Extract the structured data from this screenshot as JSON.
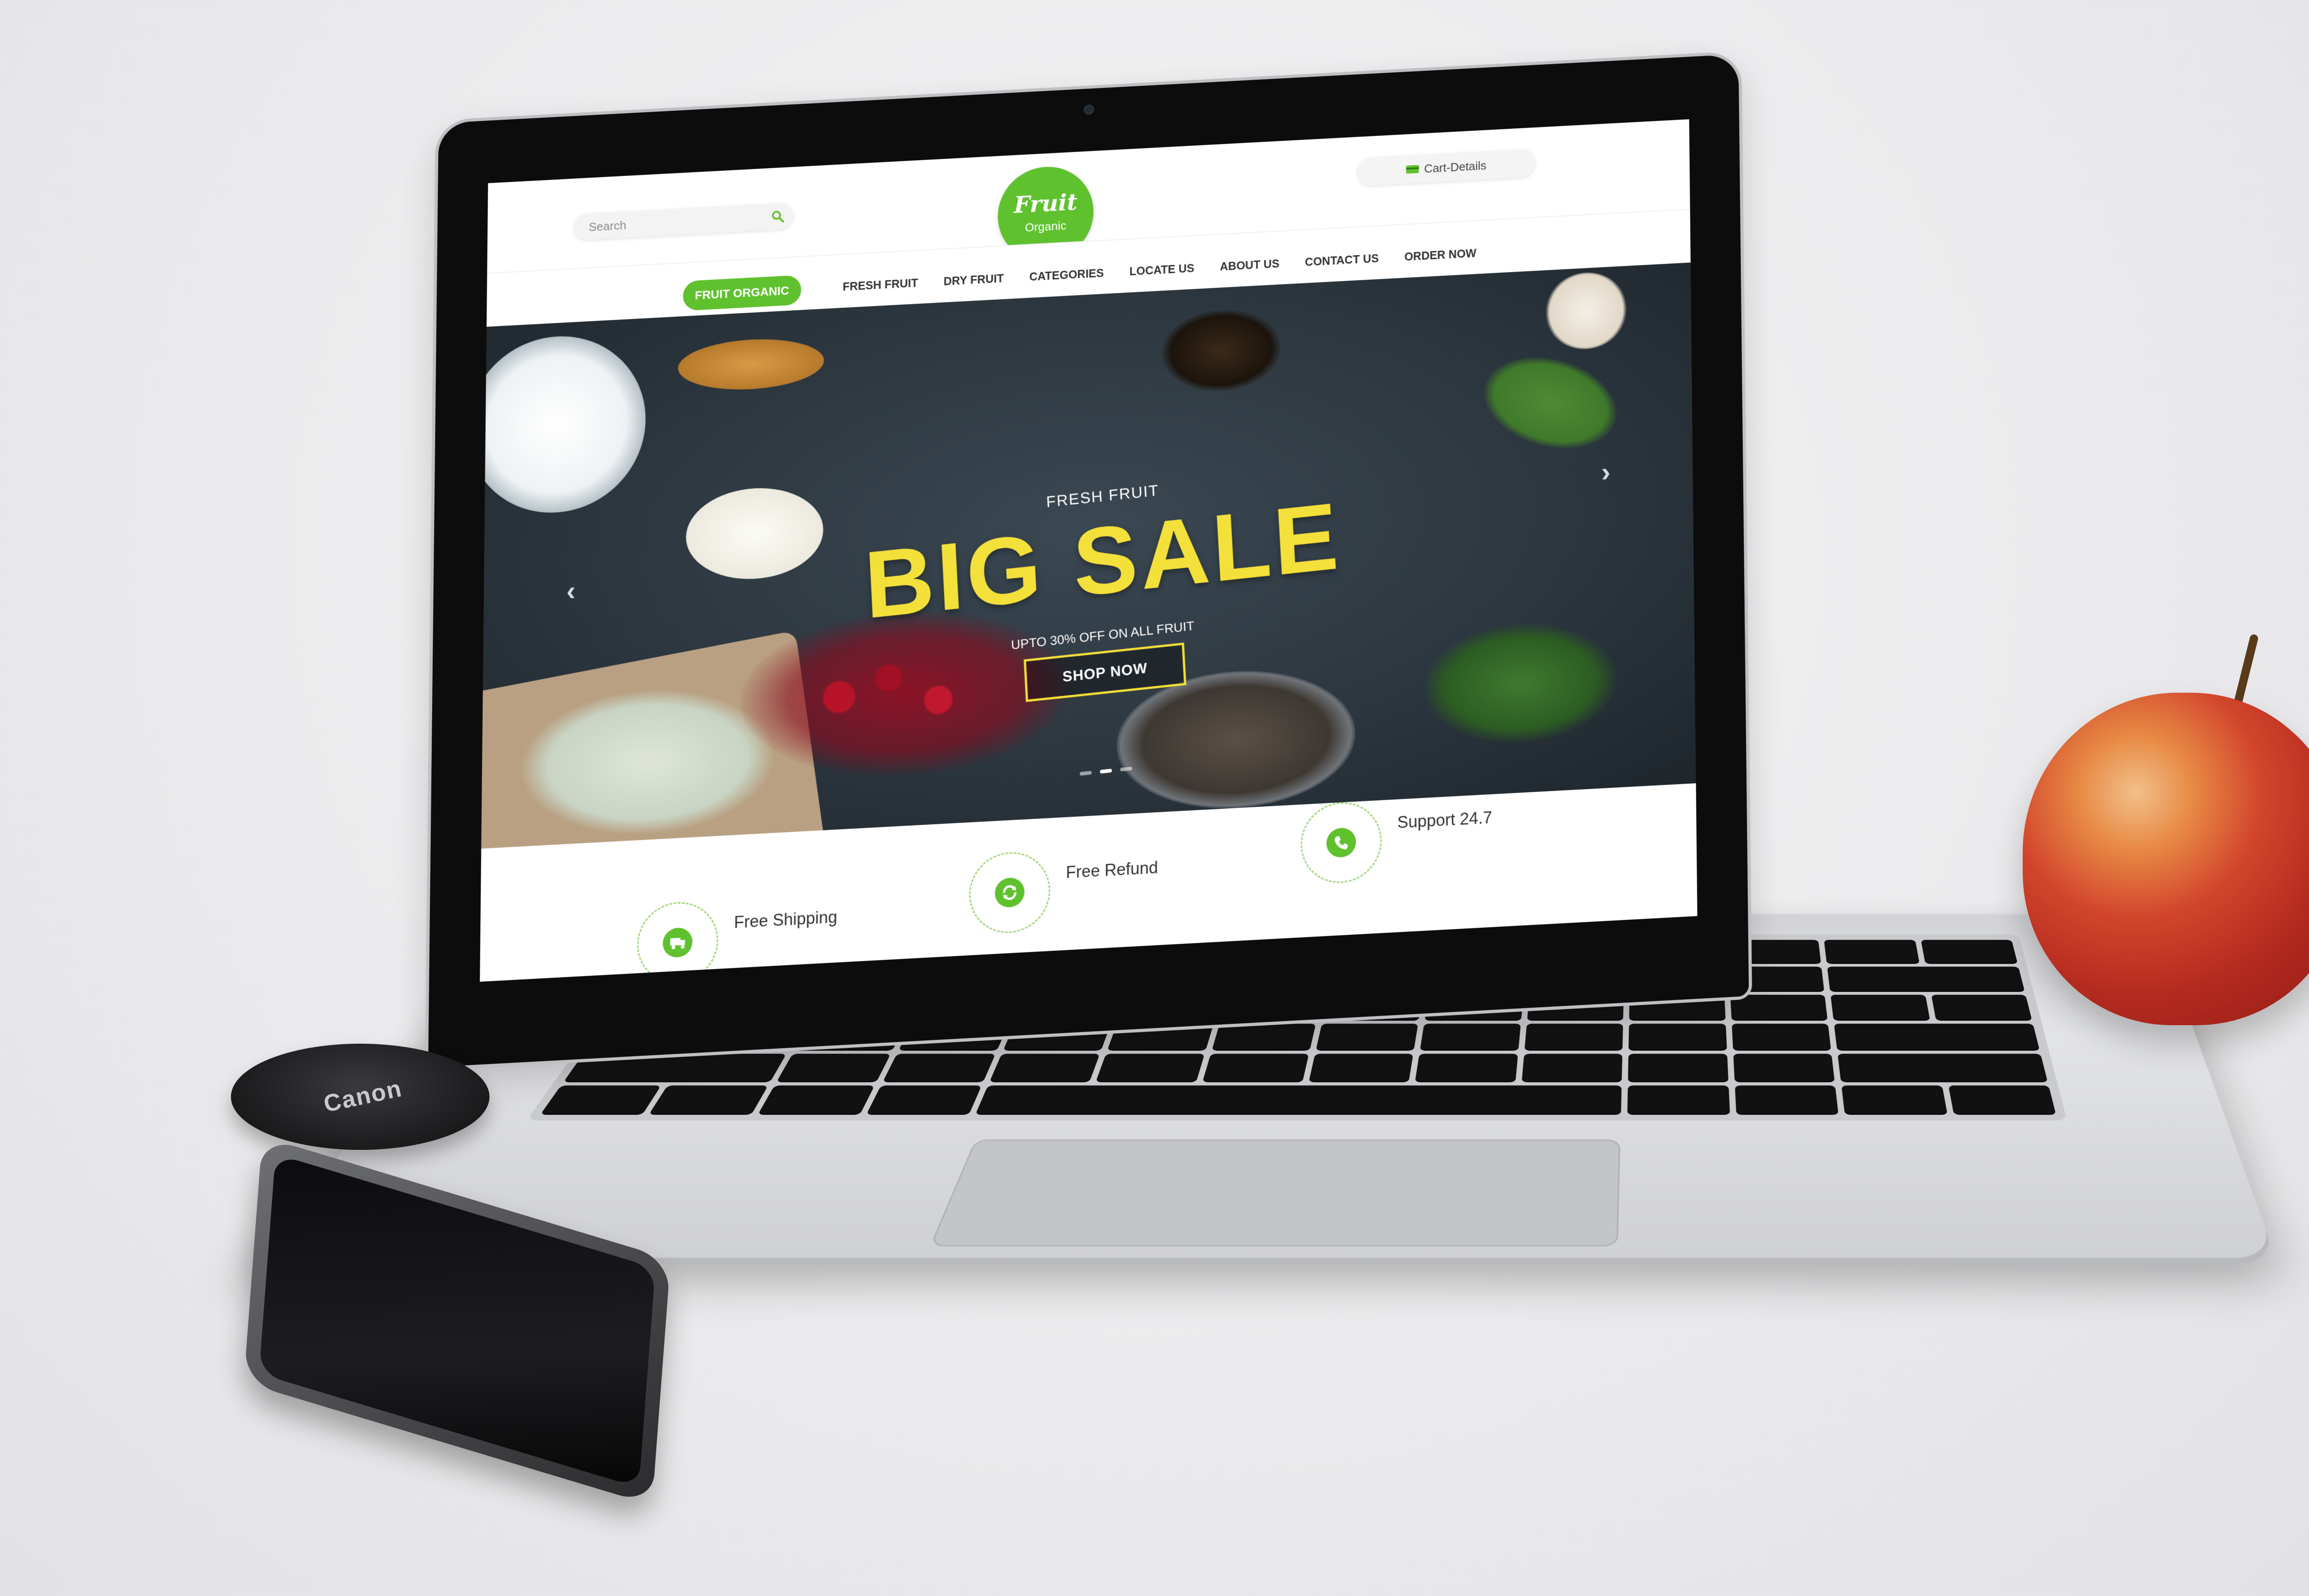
{
  "header": {
    "search_placeholder": "Search",
    "logo": {
      "main": "Fruit",
      "sub": "Organic"
    },
    "cart_label": "Cart-Details"
  },
  "nav": {
    "active": "FRUIT ORGANIC",
    "links": [
      "FRESH FRUIT",
      "DRY FRUIT",
      "CATEGORIES",
      "LOCATE US",
      "ABOUT US",
      "CONTACT US",
      "ORDER NOW"
    ]
  },
  "hero": {
    "kicker": "FRESH FRUIT",
    "title": "BIG SALE",
    "subtitle": "UPTO 30% OFF ON ALL FRUIT",
    "cta": "SHOP NOW",
    "prev_icon": "chevron-left-icon",
    "next_icon": "chevron-right-icon",
    "slides_count": 3,
    "active_slide": 2
  },
  "features": [
    {
      "title": "Free Shipping",
      "icon": "truck-icon"
    },
    {
      "title": "Free Refund",
      "icon": "refresh-icon"
    },
    {
      "title": "Support 24.7",
      "icon": "phone-icon"
    }
  ],
  "props": {
    "lens_cap_text": "Canon"
  },
  "colors": {
    "brand_green": "#5fc12e",
    "sale_yellow": "#f4e03a",
    "hero_bg": "#2b353d"
  }
}
